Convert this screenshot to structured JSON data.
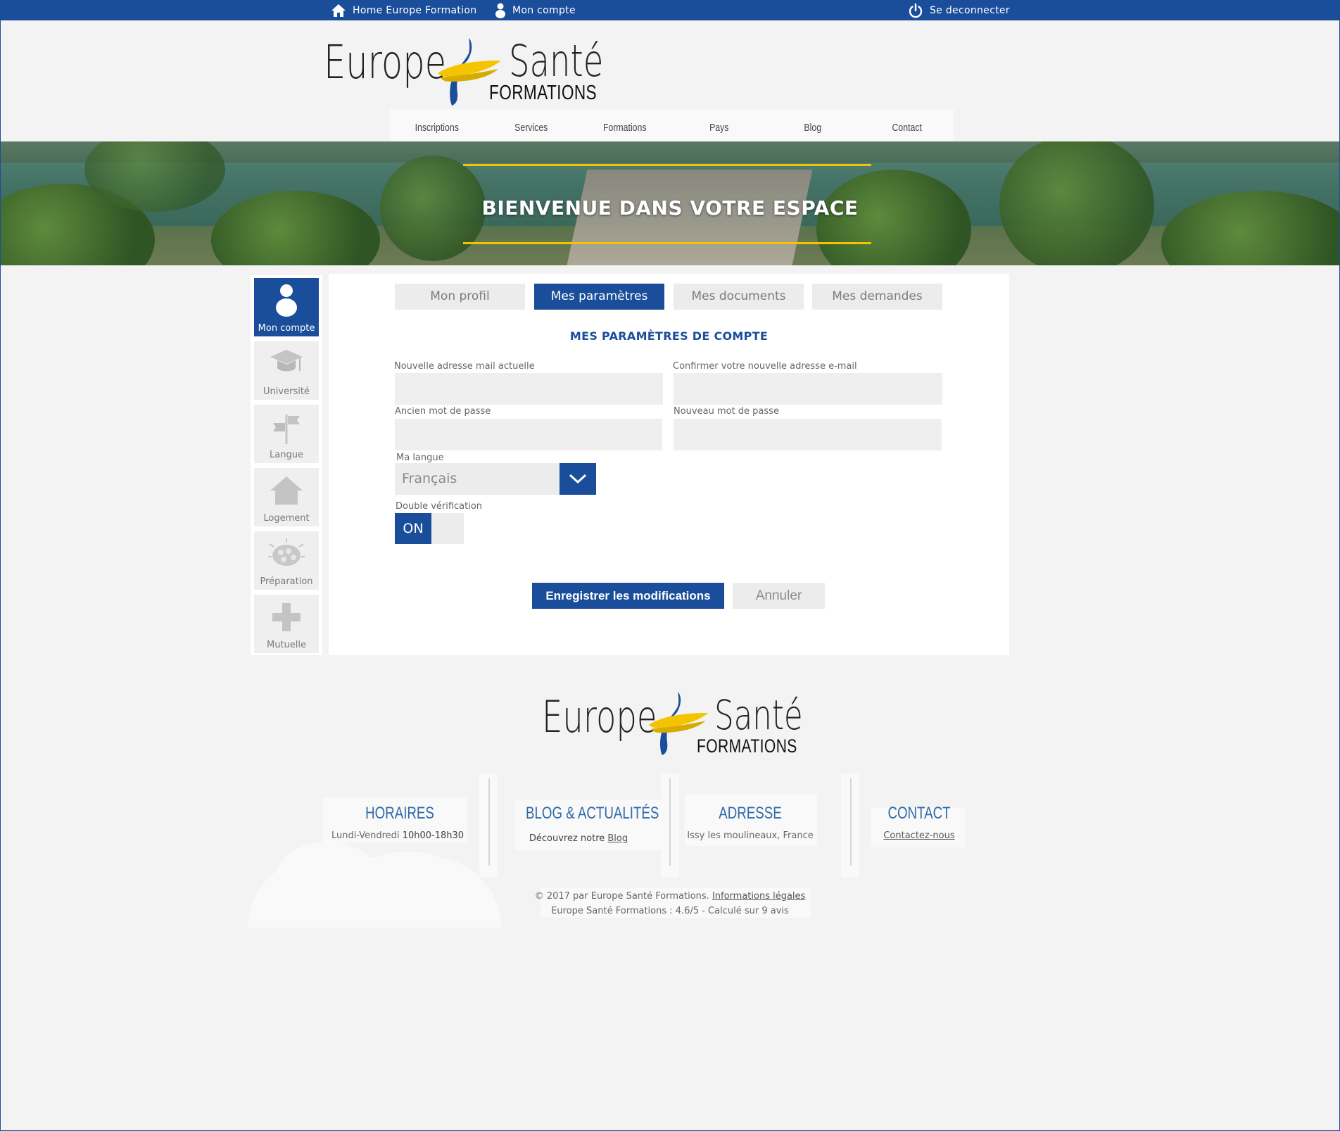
{
  "topbar": {
    "home_label": "Home Europe Formation",
    "account_label": "Mon compte",
    "logout_label": "Se deconnecter",
    "home_icon": "home-icon",
    "account_icon": "user-icon",
    "logout_icon": "power-icon"
  },
  "logo": {
    "word1": "Europe",
    "word2": "Santé",
    "word3": "FORMATIONS"
  },
  "nav": {
    "items": [
      "Inscriptions",
      "Services",
      "Formations",
      "Pays",
      "Blog",
      "Contact"
    ]
  },
  "banner": {
    "title": "BIENVENUE DANS VOTRE ESPACE"
  },
  "sidebar": {
    "items": [
      {
        "label": "Mon compte",
        "icon": "user-icon",
        "active": true
      },
      {
        "label": "Université",
        "icon": "graduation-cap-icon",
        "active": false
      },
      {
        "label": "Langue",
        "icon": "signpost-icon",
        "active": false
      },
      {
        "label": "Logement",
        "icon": "house-icon",
        "active": false
      },
      {
        "label": "Préparation",
        "icon": "brain-icon",
        "active": false
      },
      {
        "label": "Mutuelle",
        "icon": "plus-cross-icon",
        "active": false
      }
    ]
  },
  "tabs": [
    {
      "label": "Mon profil",
      "active": false
    },
    {
      "label": "Mes paramètres",
      "active": true
    },
    {
      "label": "Mes documents",
      "active": false
    },
    {
      "label": "Mes demandes",
      "active": false
    }
  ],
  "form": {
    "section_title": "MES PARAMÈTRES DE COMPTE",
    "new_email_label": "Nouvelle adresse mail actuelle",
    "confirm_email_label": "Confirmer votre nouvelle adresse e-mail",
    "old_password_label": "Ancien mot de passe",
    "new_password_label": "Nouveau mot de passe",
    "language_label": "Ma langue",
    "language_value": "Français",
    "double_verif_label": "Double vérification",
    "double_verif_state": "ON",
    "save_label": "Enregistrer les modifications",
    "cancel_label": "Annuler"
  },
  "footer": {
    "hours_title": "HORAIRES",
    "hours_days": "Lundi-Vendredi",
    "hours_time": "10h00-18h30",
    "blog_title": "BLOG & ACTUALITÉS",
    "blog_text": "Découvrez notre",
    "blog_link": "Blog",
    "address_title": "ADRESSE",
    "address_text": "Issy les moulineaux, France",
    "contact_title": "CONTACT",
    "contact_link": "Contactez-nous",
    "copyright": "© 2017 par Europe Santé Formations.",
    "legal_link": "Informations légales",
    "rating": "Europe Santé Formations : 4.6/5 - Calculé sur 9 avis"
  },
  "colors": {
    "brand_blue": "#1a4e9b",
    "accent_yellow": "#f5c400",
    "footer_heading": "#2e6aa8"
  }
}
